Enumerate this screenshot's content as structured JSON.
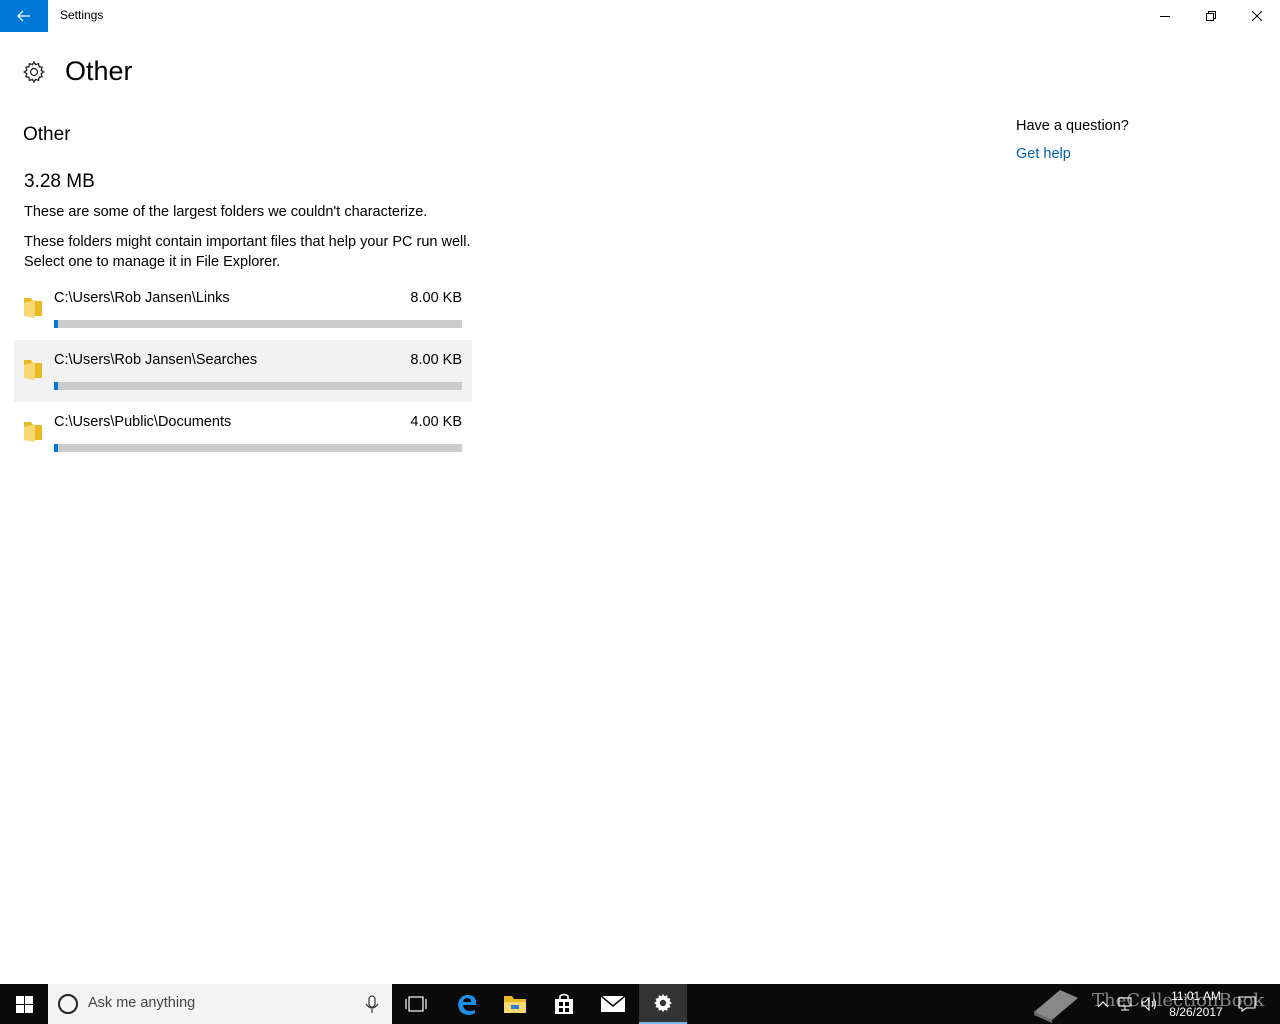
{
  "window": {
    "title": "Settings",
    "back_icon": "back-arrow-icon",
    "accent": "#0078d7"
  },
  "page": {
    "title": "Other",
    "icon": "gear-icon"
  },
  "section": {
    "heading": "Other",
    "total_size": "3.28 MB",
    "description1": "These are some of the largest folders we couldn't characterize.",
    "description2": "These folders might contain important files that help your PC run well. Select one to manage it in File Explorer."
  },
  "folders": [
    {
      "path": "C:\\Users\\Rob Jansen\\Links",
      "size": "8.00 KB",
      "fill_fraction": 0.01
    },
    {
      "path": "C:\\Users\\Rob Jansen\\Searches",
      "size": "8.00 KB",
      "fill_fraction": 0.01
    },
    {
      "path": "C:\\Users\\Public\\Documents",
      "size": "4.00 KB",
      "fill_fraction": 0.01
    }
  ],
  "help": {
    "question": "Have a question?",
    "link": "Get help"
  },
  "taskbar": {
    "search_placeholder": "Ask me anything",
    "time": "11:01 AM",
    "date": "8/26/2017",
    "watermark": "TheCollectionBook"
  }
}
